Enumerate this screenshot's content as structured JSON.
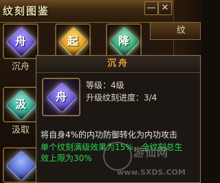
{
  "header": {
    "title": "纹刻图鉴",
    "minimize_glyph": "—",
    "close_glyph": "✕"
  },
  "side_tab": {
    "label": "纹"
  },
  "runes": [
    {
      "label": "沉舟",
      "glyph": "舟",
      "color": "#6a5ad8",
      "glow": "#b8a8ff"
    },
    {
      "label": "",
      "glyph": "起",
      "color": "#e0a020",
      "glow": "#ffe070"
    },
    {
      "label": "",
      "glyph": "降",
      "color": "#3aa878",
      "glow": "#a8f0c8"
    },
    {
      "label": "汲取",
      "glyph": "汲",
      "color": "#30a890",
      "glow": "#a0f0d8"
    },
    {
      "label": "",
      "glyph": "",
      "color": "#5a70d0",
      "glow": "#a0b8ff"
    }
  ],
  "tooltip": {
    "title": "沉舟",
    "icon_glyph": "舟",
    "level": "等级：4级",
    "progress": "升级纹刻进度：3/4",
    "description": "将自身4%的内功防御转化为内功攻击",
    "bonus_line1": "单个纹刻满级效果为15%，全纹刻总生",
    "bonus_line2": "效上限为30%"
  },
  "watermark": {
    "text": "游仙网",
    "url": "www.SXDS.COM"
  },
  "colors": {
    "title_orange": "#e8a040",
    "bonus_green": "#28d850",
    "border_gold": "#8a6a3a"
  }
}
